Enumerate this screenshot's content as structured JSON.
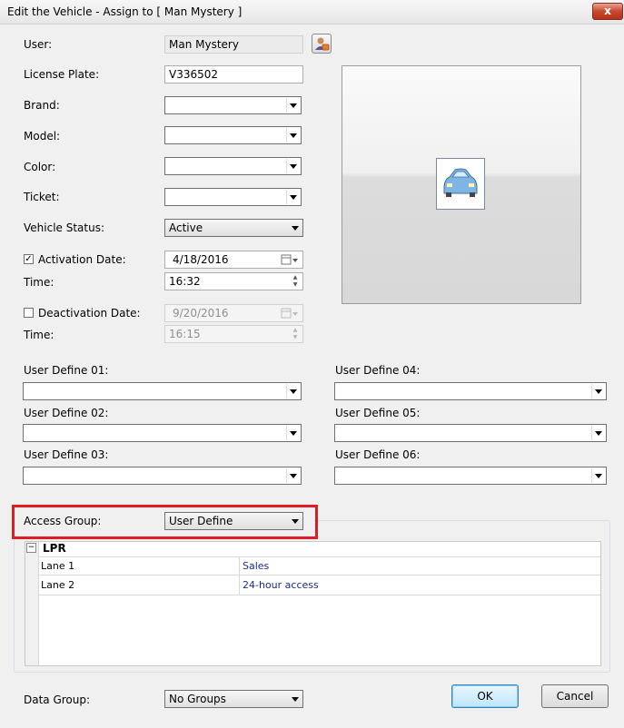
{
  "window": {
    "title": "Edit the Vehicle - Assign to [ Man Mystery ]",
    "close_glyph": "x"
  },
  "form": {
    "user_label": "User:",
    "user_value": "Man Mystery",
    "license_label": "License Plate:",
    "license_value": "V336502",
    "brand_label": "Brand:",
    "brand_value": "",
    "model_label": "Model:",
    "model_value": "",
    "color_label": "Color:",
    "color_value": "",
    "ticket_label": "Ticket:",
    "ticket_value": "",
    "status_label": "Vehicle Status:",
    "status_value": "Active",
    "activation_label": "Activation Date:",
    "activation_checked": true,
    "activation_check_glyph": "✓",
    "activation_value": "4/18/2016",
    "time_label": "Time:",
    "activation_time": "16:32",
    "deactivation_label": "Deactivation Date:",
    "deactivation_checked": false,
    "deactivation_value": "9/20/2016",
    "time2_label": "Time:",
    "deactivation_time": "16:15"
  },
  "user_defines": [
    {
      "label": "User Define 01:",
      "value": ""
    },
    {
      "label": "User Define 02:",
      "value": ""
    },
    {
      "label": "User Define 03:",
      "value": ""
    },
    {
      "label": "User Define 04:",
      "value": ""
    },
    {
      "label": "User Define 05:",
      "value": ""
    },
    {
      "label": "User Define 06:",
      "value": ""
    }
  ],
  "access": {
    "label": "Access Group:",
    "value": "User Define",
    "tree_expander": "−",
    "tree_root": "LPR",
    "rows": [
      {
        "name": "Lane 1",
        "value": "Sales"
      },
      {
        "name": "Lane 2",
        "value": "24-hour access"
      }
    ]
  },
  "footer": {
    "data_group_label": "Data Group:",
    "data_group_value": "No Groups",
    "ok_label": "OK",
    "cancel_label": "Cancel"
  },
  "colors": {
    "highlight_border": "#e01b24",
    "link_text": "#1a2d8c"
  },
  "icons": {
    "user_lookup": "user-card-icon",
    "car": "car-icon",
    "calendar": "calendar-icon"
  }
}
